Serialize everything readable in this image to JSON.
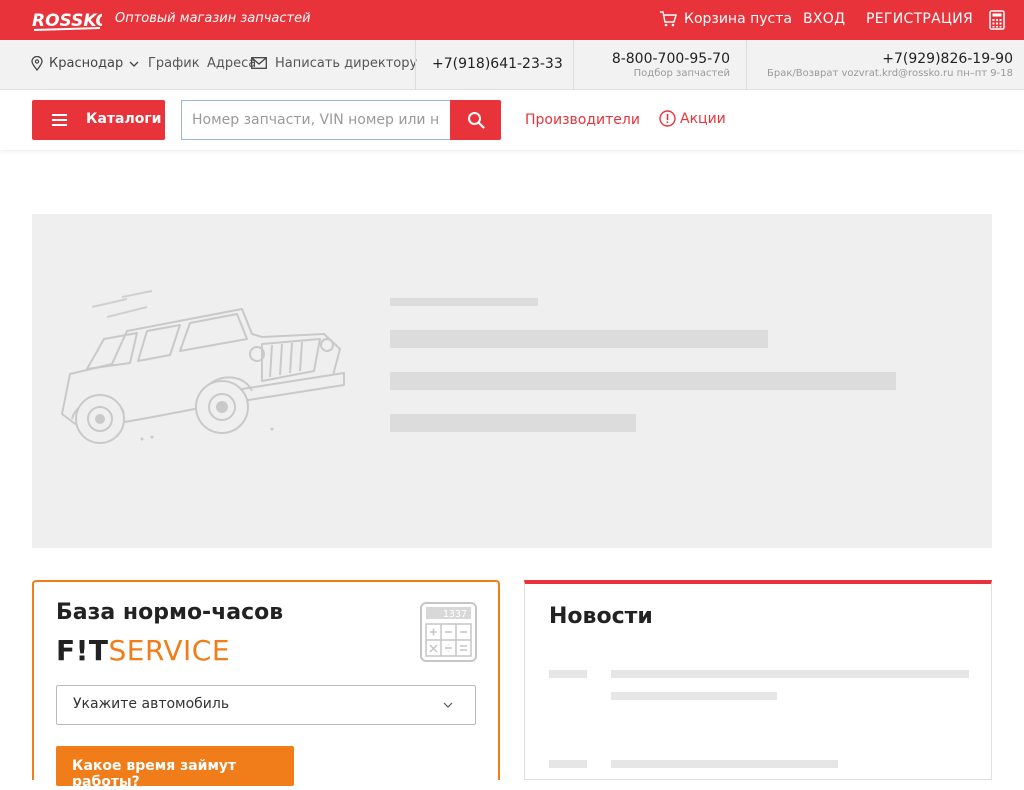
{
  "header": {
    "logo_text": "ROSSKO",
    "tagline": "Оптовый магазин запчастей",
    "cart_label": "Корзина пуста",
    "login_label": "ВХОД",
    "register_label": "РЕГИСТРАЦИЯ",
    "brand_color": "#e8333a"
  },
  "infobar": {
    "city": "Краснодар",
    "schedule": "График",
    "addresses": "Адреса",
    "write_director": "Написать директору",
    "phone_main": "+7(918)641-23-33",
    "phone_parts": "8-800-700-95-70",
    "phone_parts_sub": "Подбор запчастей",
    "phone_returns": "+7(929)826-19-90",
    "phone_returns_sub": "Брак/Возврат vozvrat.krd@rossko.ru пн–пт 9-18"
  },
  "searchrow": {
    "catalog_label": "Каталоги",
    "search_placeholder": "Номер запчасти, VIN номер или номер",
    "producers": "Производители",
    "promo": "Акции"
  },
  "normcard": {
    "title": "База нормо-часов",
    "brand_dark": "F!T",
    "brand_orange": "SERVICE",
    "calc_display": "1337",
    "select_label": "Укажите автомобиль",
    "button_label": "Какое время займут работы?",
    "accent_color": "#f07d1a"
  },
  "news": {
    "title": "Новости"
  }
}
